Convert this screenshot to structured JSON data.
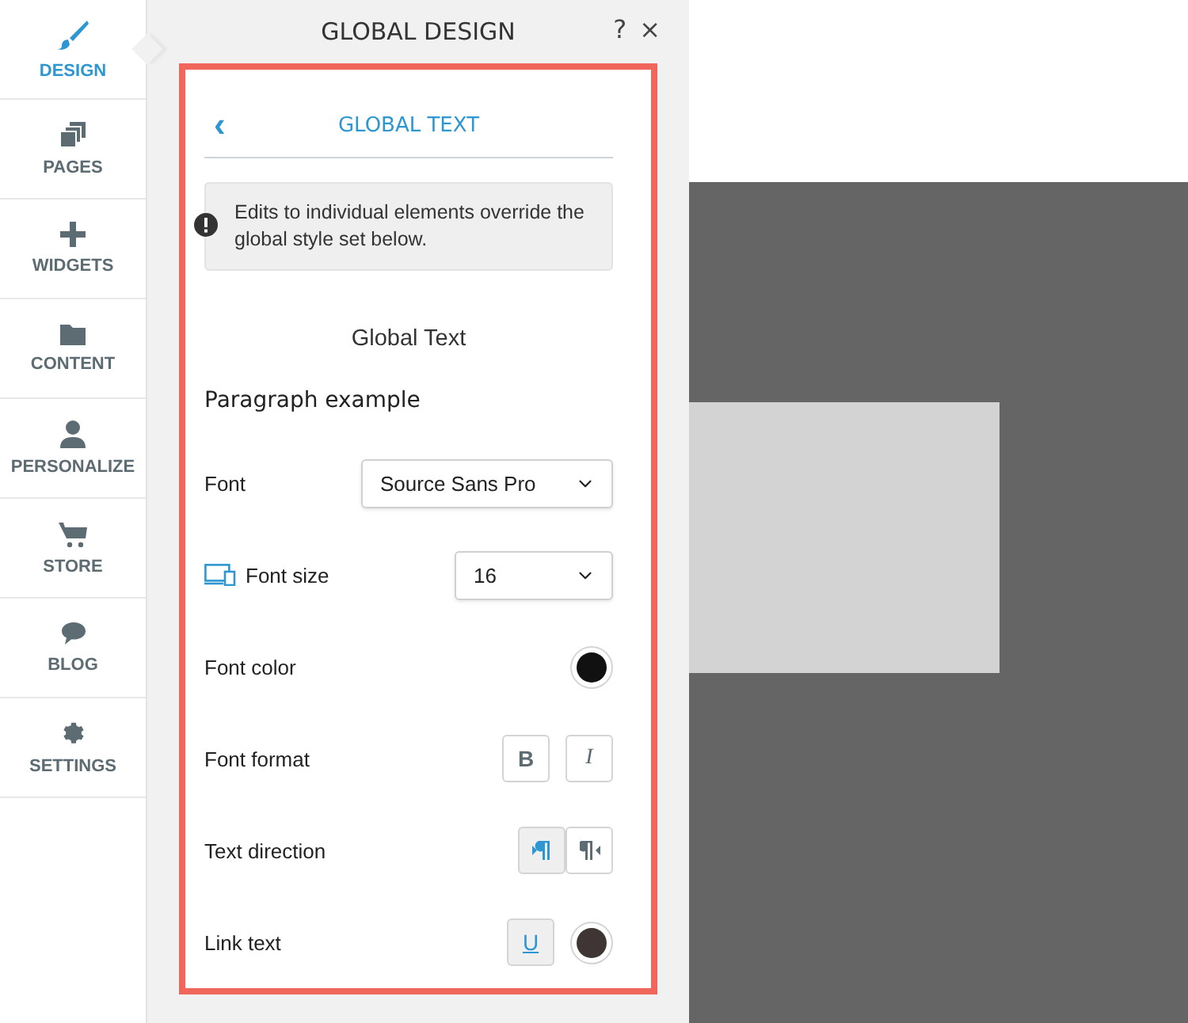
{
  "sidebar": {
    "items": [
      {
        "label": "DESIGN",
        "selected": true
      },
      {
        "label": "PAGES",
        "selected": false
      },
      {
        "label": "WIDGETS",
        "selected": false
      },
      {
        "label": "CONTENT",
        "selected": false
      },
      {
        "label": "PERSONALIZE",
        "selected": false
      },
      {
        "label": "STORE",
        "selected": false
      },
      {
        "label": "BLOG",
        "selected": false
      },
      {
        "label": "SETTINGS",
        "selected": false
      }
    ]
  },
  "panel": {
    "title": "GLOBAL DESIGN",
    "help": "?",
    "close": "×",
    "subtitle": "GLOBAL TEXT",
    "back": "‹",
    "notice": "Edits to individual elements override the global style set below.",
    "section_title": "Global Text",
    "example": "Paragraph example",
    "rows": [
      {
        "kind": "select",
        "label": "Font",
        "value": "Source Sans Pro"
      },
      {
        "kind": "select",
        "label": "Font size",
        "value": "16"
      },
      {
        "kind": "color",
        "label": "Font color",
        "color": "#111111"
      },
      {
        "kind": "toggles",
        "label": "Font format",
        "options": [
          {
            "label": "B",
            "selected": false
          },
          {
            "label": "I",
            "selected": false
          }
        ]
      },
      {
        "kind": "direction",
        "label": "Text direction",
        "options": [
          {
            "selected": true
          },
          {
            "selected": false
          }
        ]
      },
      {
        "kind": "link",
        "label": "Link text",
        "options": [
          {
            "label": "U",
            "selected": true
          }
        ],
        "color": "#3e3534"
      }
    ]
  }
}
